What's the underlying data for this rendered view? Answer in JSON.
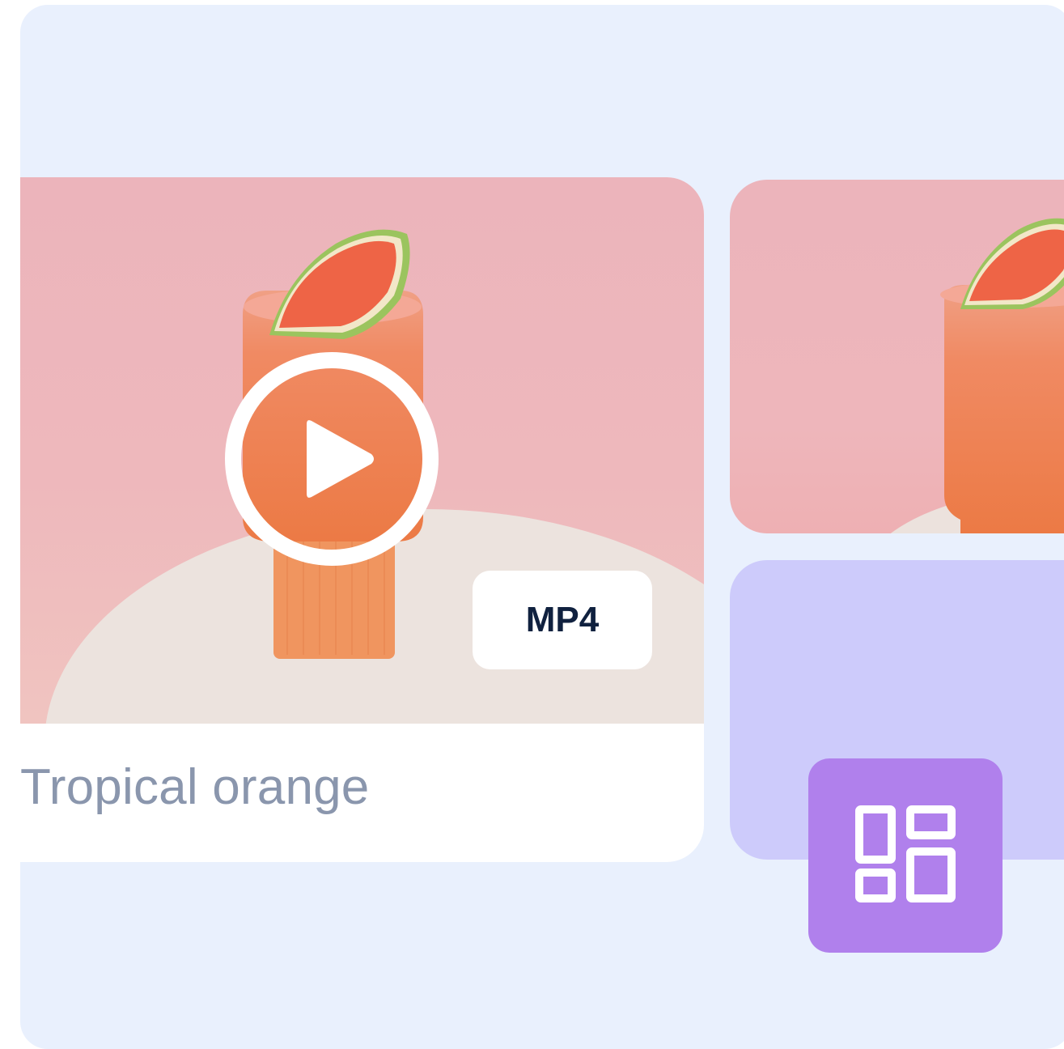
{
  "card": {
    "title": "Tropical orange",
    "format_badge": "MP4"
  },
  "icons": {
    "play": "play-circle-icon",
    "layout": "layout-grid-icon"
  },
  "colors": {
    "panel_background": "#e9f0fd",
    "title_text": "#8a96ad",
    "badge_text": "#10213f",
    "lavender_card": "#cdcbfb",
    "layout_button": "#b080ec"
  }
}
